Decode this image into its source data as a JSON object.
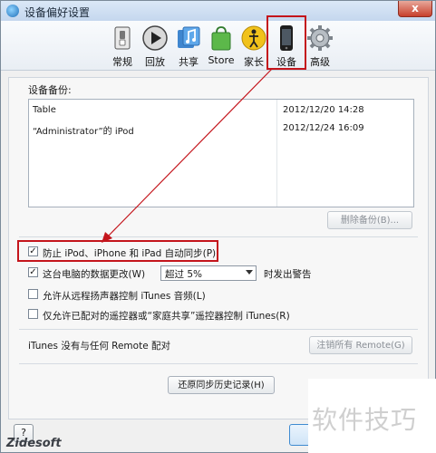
{
  "window": {
    "title": "设备偏好设置",
    "close_label": "x"
  },
  "toolbar": {
    "items": [
      {
        "label": "常规",
        "icon": "switch-icon"
      },
      {
        "label": "回放",
        "icon": "play-icon"
      },
      {
        "label": "共享",
        "icon": "music-share-icon"
      },
      {
        "label": "Store",
        "icon": "store-bag-icon"
      },
      {
        "label": "家长",
        "icon": "parental-icon"
      },
      {
        "label": "设备",
        "icon": "iphone-icon",
        "selected": true
      },
      {
        "label": "高级",
        "icon": "gear-icon"
      }
    ]
  },
  "backups": {
    "label": "设备备份:",
    "rows": [
      {
        "name": "Table",
        "date": "2012/12/20 14:28"
      },
      {
        "name": "“Administrator”的 iPod",
        "date": "2012/12/24 16:09"
      }
    ],
    "delete_button": "删除备份(B)..."
  },
  "options": {
    "prevent_sync": {
      "label": "防止 iPod、iPhone 和 iPad 自动同步(P)",
      "checked": true
    },
    "data_change": {
      "label": "这台电脑的数据更改(W)",
      "checked": true
    },
    "threshold": {
      "value": "超过 5%"
    },
    "warn_suffix": "时发出警告",
    "remote_speakers": {
      "label": "允许从远程扬声器控制 iTunes 音频(L)",
      "checked": false
    },
    "paired_remotes": {
      "label": "仅允许已配对的遥控器或“家庭共享”遥控器控制 iTunes(R)",
      "checked": false
    }
  },
  "remote": {
    "status": "iTunes 没有与任何 Remote 配对",
    "unpair_button": "注销所有 Remote(G)"
  },
  "reset_button": "还原同步历史记录(H)",
  "footer": {
    "help_label": "?",
    "brand": "Zidesoft"
  },
  "watermark": "软件技巧",
  "colors": {
    "highlight": "#c4151c",
    "titlebar": "#c5d7ee"
  }
}
